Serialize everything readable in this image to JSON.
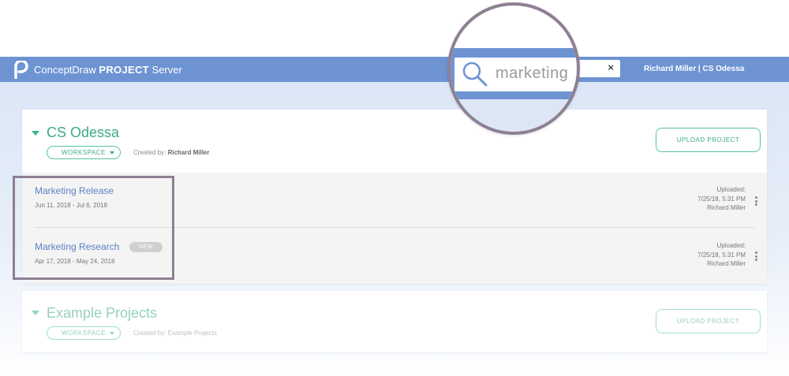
{
  "app": {
    "name": "ConceptDraw",
    "name_bold": "PROJECT",
    "name_suffix": "Server"
  },
  "search": {
    "value": "marketing",
    "clear_label": "×"
  },
  "user": {
    "label": "Richard Miller | CS Odessa"
  },
  "workspaces": [
    {
      "title": "CS Odessa",
      "badge": "WORKSPACE",
      "created_label": "Created by:",
      "created_by": "Richard Miller",
      "upload_label": "UPLOAD PROJECT",
      "projects": [
        {
          "name": "Marketing Release",
          "dates": "Jun 11, 2018 - Jul 6, 2018",
          "uploaded_label": "Uploaded:",
          "uploaded_at": "7/25/18, 5:31 PM",
          "uploaded_by": "Richard Miller"
        },
        {
          "name": "Marketing Research",
          "badge": "NEW",
          "dates": "Apr 17, 2018 - May 24, 2018",
          "uploaded_label": "Uploaded:",
          "uploaded_at": "7/25/18, 5:31 PM",
          "uploaded_by": "Richard Miller"
        }
      ]
    },
    {
      "title": "Example Projects",
      "badge": "WORKSPACE",
      "created_label": "Created by:",
      "created_by": "Example Projects",
      "upload_label": "UPLOAD PROJECT"
    }
  ],
  "colors": {
    "header": "#6d93d3",
    "accent": "#3fa98a",
    "link": "#5b80c4",
    "highlight": "#8e7f93"
  }
}
